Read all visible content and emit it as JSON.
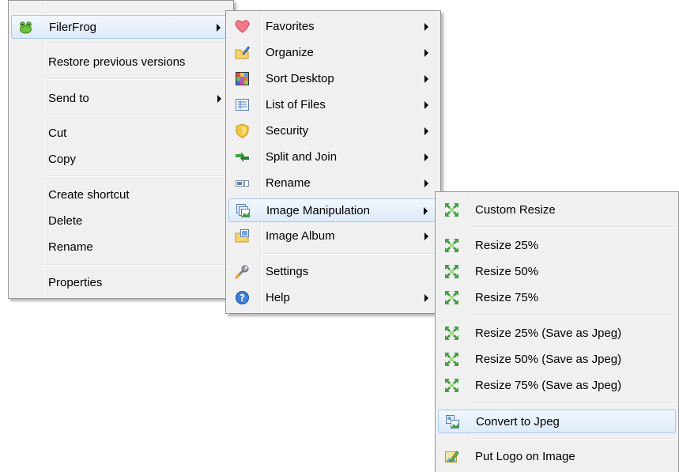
{
  "menu1": {
    "filerfrog": "FilerFrog",
    "restore": "Restore previous versions",
    "send_to": "Send to",
    "cut": "Cut",
    "copy": "Copy",
    "create_shortcut": "Create shortcut",
    "delete": "Delete",
    "rename": "Rename",
    "properties": "Properties"
  },
  "menu2": {
    "favorites": "Favorites",
    "organize": "Organize",
    "sort_desktop": "Sort Desktop",
    "list_of_files": "List of Files",
    "security": "Security",
    "split_and_join": "Split and Join",
    "rename": "Rename",
    "image_manipulation": "Image Manipulation",
    "image_album": "Image Album",
    "settings": "Settings",
    "help": "Help"
  },
  "menu3": {
    "custom_resize": "Custom Resize",
    "resize_25": "Resize 25%",
    "resize_50": "Resize 50%",
    "resize_75": "Resize 75%",
    "resize_25_jpeg": "Resize 25% (Save as Jpeg)",
    "resize_50_jpeg": "Resize 50% (Save as Jpeg)",
    "resize_75_jpeg": "Resize 75% (Save as Jpeg)",
    "convert_to_jpeg": "Convert to Jpeg",
    "put_logo": "Put Logo on Image"
  },
  "icons": {
    "frog": "frog-icon",
    "heart": "heart-icon",
    "organize": "folder-pencil-icon",
    "sort_desktop": "color-grid-icon",
    "list": "list-icon",
    "security": "shield-icon",
    "split": "split-join-arrows-icon",
    "rename": "rename-icon",
    "image_manipulation": "image-stack-icon",
    "image_album": "folder-picture-icon",
    "settings": "wrench-icon",
    "help": "help-icon",
    "resize": "resize-arrows-icon",
    "convert": "convert-image-icon",
    "logo": "image-pencil-icon"
  },
  "colors": {
    "menu_bg": "#f0f0f0",
    "menu_border": "#979797",
    "highlight_border": "#a9c9ec",
    "resize_green": "#3fa23f"
  }
}
